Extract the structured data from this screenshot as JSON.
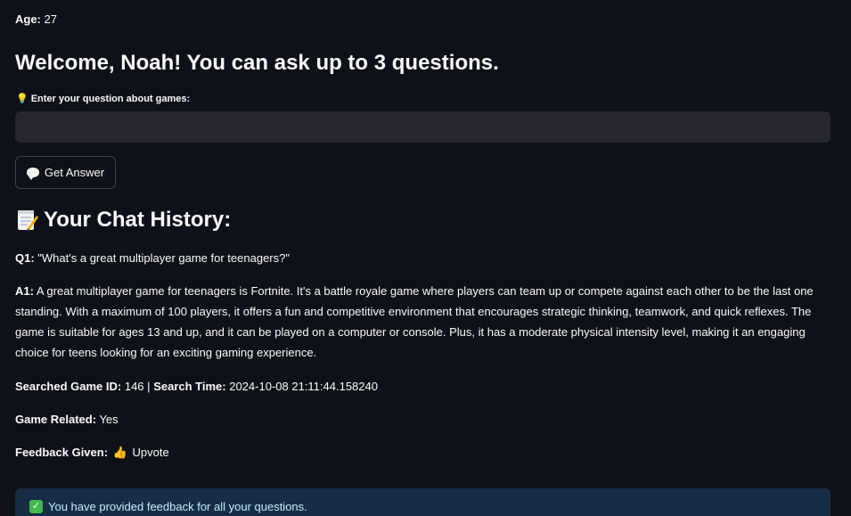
{
  "user": {
    "age_label": "Age:",
    "age_value": "27"
  },
  "welcome_text": "Welcome, Noah! You can ask up to 3 questions.",
  "question_form": {
    "label_icon": "lightbulb-icon",
    "label": "Enter your question about games:",
    "input_value": "",
    "button_icon": "speech-bubble-icon",
    "button_label": "Get Answer"
  },
  "history": {
    "heading_icon": "memo-icon",
    "heading": "Your Chat History:",
    "q_label": "Q1:",
    "q_text": "\"What's a great multiplayer game for teenagers?\"",
    "a_label": "A1:",
    "a_text": "A great multiplayer game for teenagers is Fortnite. It's a battle royale game where players can team up or compete against each other to be the last one standing. With a maximum of 100 players, it offers a fun and competitive environment that encourages strategic thinking, teamwork, and quick reflexes. The game is suitable for ages 13 and up, and it can be played on a computer or console. Plus, it has a moderate physical intensity level, making it an engaging choice for teens looking for an exciting gaming experience.",
    "game_id_label": "Searched Game ID:",
    "game_id_value": "146",
    "separator": "|",
    "search_time_label": "Search Time:",
    "search_time_value": "2024-10-08 21:11:44.158240",
    "related_label": "Game Related:",
    "related_value": "Yes",
    "feedback_label": "Feedback Given:",
    "feedback_icon": "thumbs-up-icon",
    "feedback_value": "Upvote"
  },
  "info_message": {
    "icon": "check-mark-icon",
    "text": "You have provided feedback for all your questions."
  },
  "colors": {
    "background": "#0e1117",
    "input_background": "#262730",
    "info_background": "#172d43",
    "info_text": "#c7ebff"
  }
}
